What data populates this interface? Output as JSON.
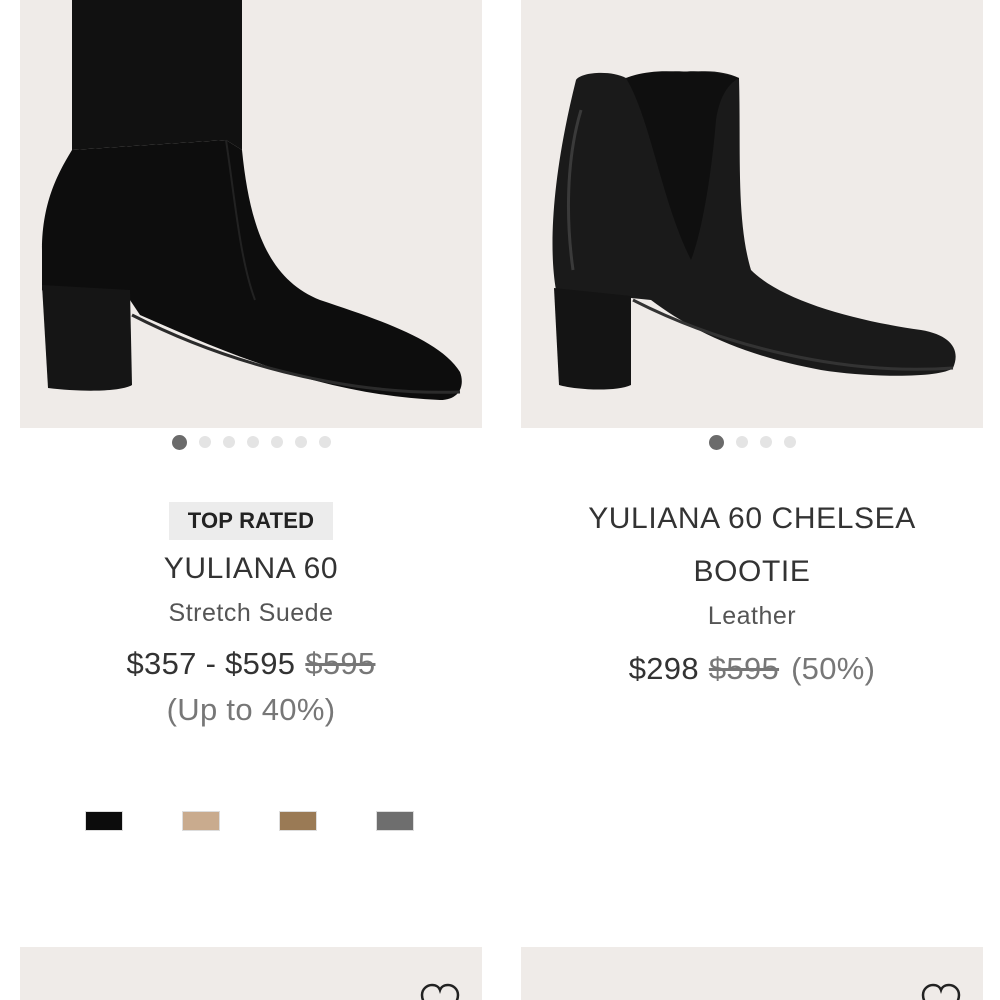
{
  "products": [
    {
      "badge": "TOP RATED",
      "name": "YULIANA 60",
      "material": "Stretch Suede",
      "price": "$357 - $595",
      "original_price": "$595",
      "discount": "(Up to 40%)",
      "image_count": 7,
      "active_image": 0,
      "swatches": [
        "#0c0c0c",
        "#c9ab8e",
        "#9a7a55",
        "#6e6e6e"
      ],
      "image_icon": "suede-sock-bootie-image"
    },
    {
      "badge": "",
      "name_line1": "YULIANA 60 CHELSEA",
      "name_line2": "BOOTIE",
      "material": "Leather",
      "price": "$298",
      "original_price": "$595",
      "discount": "(50%)",
      "image_count": 4,
      "active_image": 0,
      "image_icon": "leather-chelsea-bootie-image"
    }
  ],
  "wishlist_icon": "heart-icon",
  "colors": {
    "image_background": "#efebe8",
    "badge_background": "#ececec",
    "dot_active": "#6b6b6b",
    "dot_inactive": "#e4e4e4"
  }
}
